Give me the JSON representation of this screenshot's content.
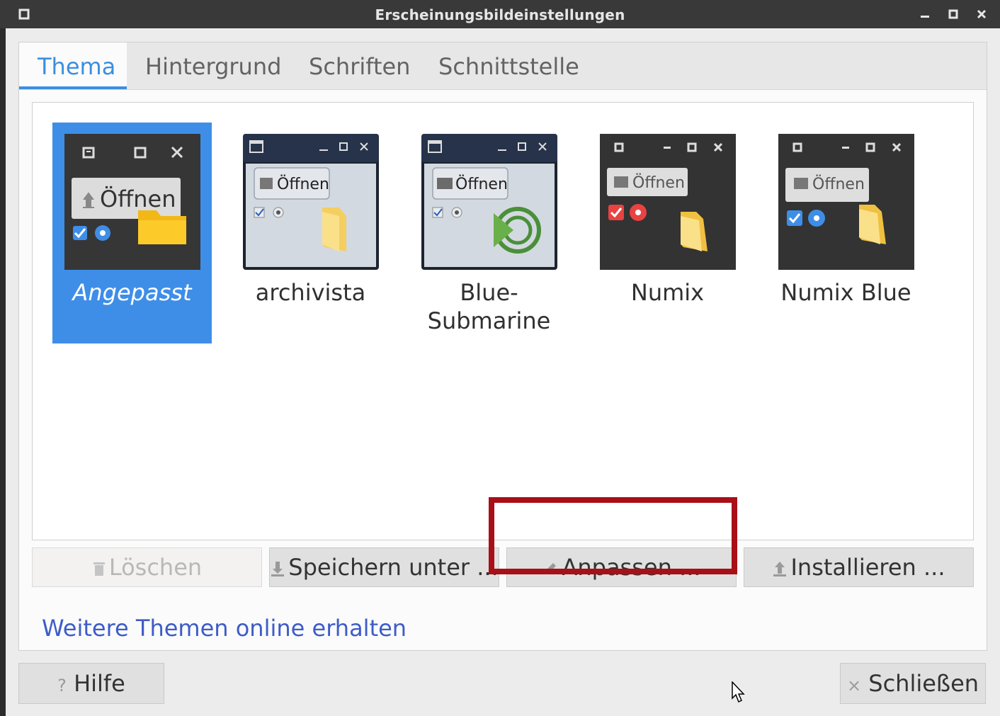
{
  "window": {
    "title": "Erscheinungsbildeinstellungen"
  },
  "tabs": [
    {
      "label": "Thema",
      "active": true
    },
    {
      "label": "Hintergrund",
      "active": false
    },
    {
      "label": "Schriften",
      "active": false
    },
    {
      "label": "Schnittstelle",
      "active": false
    }
  ],
  "themes": [
    {
      "label": "Angepasst",
      "selected": true,
      "preview_button": "Öffnen"
    },
    {
      "label": "archivista",
      "selected": false,
      "preview_button": "Öffnen"
    },
    {
      "label": "Blue-Submarine",
      "label_line1": "Blue-",
      "label_line2": "Submarine",
      "selected": false,
      "preview_button": "Öffnen"
    },
    {
      "label": "Numix",
      "selected": false,
      "preview_button": "Öffnen"
    },
    {
      "label": "Numix Blue",
      "selected": false,
      "preview_button": "Öffnen"
    }
  ],
  "actions": {
    "delete": "Löschen",
    "save_as": "Speichern unter ...",
    "customize": "Anpassen ...",
    "install": "Installieren ..."
  },
  "more_themes_link": "Weitere Themen online erhalten",
  "footer": {
    "help": "Hilfe",
    "close": "Schließen"
  },
  "colors": {
    "accent": "#3e8ee8",
    "link": "#3d5cc8",
    "highlight_box": "#a80f17"
  }
}
